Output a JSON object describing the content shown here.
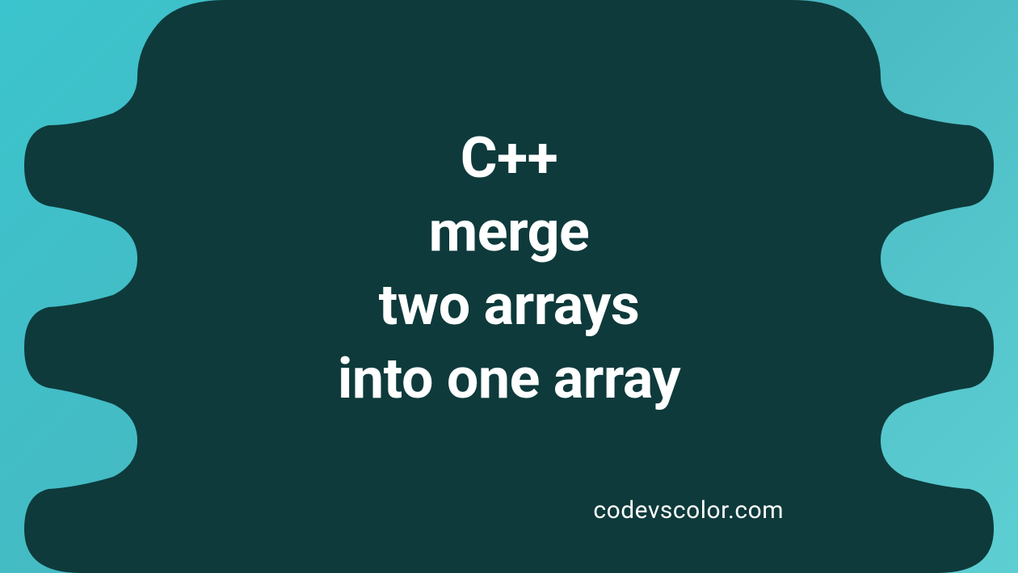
{
  "title": {
    "line1": "C++",
    "line2": "merge",
    "line3": "two arrays",
    "line4": "into one array"
  },
  "watermark": "codevscolor.com",
  "colors": {
    "background_gradient_start": "#3bc4cd",
    "background_gradient_end": "#5dcfd3",
    "blob_color": "#0e3a3b",
    "text_color": "#ffffff"
  }
}
